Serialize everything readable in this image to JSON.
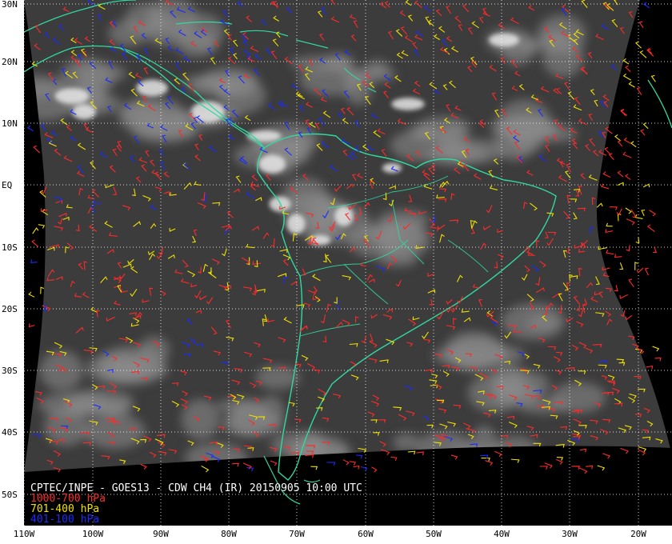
{
  "map": {
    "caption": {
      "title": "CPTEC/INPE - GOES13 - CDW CH4 (IR) 20150905 10:00 UTC",
      "legend": [
        {
          "label": "1000-700 hPa",
          "color": "#ff2a2a"
        },
        {
          "label": "701-400 hPa",
          "color": "#f0e000"
        },
        {
          "label": "401-100 hPa",
          "color": "#1a2cff"
        }
      ]
    },
    "lat_labels": [
      "30N",
      "20N",
      "10N",
      "EQ",
      "10S",
      "20S",
      "30S",
      "40S",
      "50S"
    ],
    "lon_labels": [
      "110W",
      "100W",
      "90W",
      "80W",
      "70W",
      "60W",
      "50W",
      "40W",
      "30W",
      "20W"
    ],
    "colors": {
      "frame": "#ffffff",
      "space": "#000000",
      "coastline": "#30d9a0",
      "grid": "#ffffff",
      "surface_warm": "#3a3a3a",
      "cloud": "#e6e6e6"
    }
  }
}
